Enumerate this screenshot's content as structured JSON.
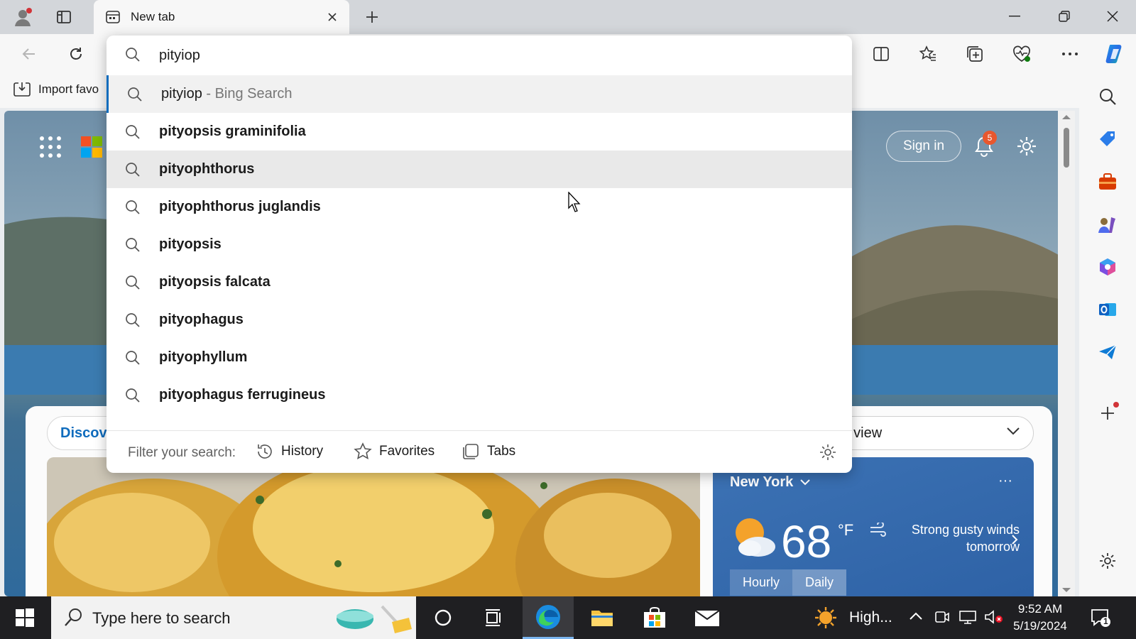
{
  "browser": {
    "tab_title": "New tab",
    "import_favorites_label": "Import favo"
  },
  "omnibox": {
    "value": "pityiop",
    "suggestions": [
      {
        "text": "pityiop",
        "suffix": " - Bing Search"
      },
      {
        "text": "pityopsis graminifolia"
      },
      {
        "text": "pityophthorus"
      },
      {
        "text": "pityophthorus juglandis"
      },
      {
        "text": "pityopsis"
      },
      {
        "text": "pityopsis falcata"
      },
      {
        "text": "pityophagus"
      },
      {
        "text": "pityophyllum"
      },
      {
        "text": "pityophagus ferrugineus"
      }
    ],
    "filter_label": "Filter your search:",
    "filters": [
      "History",
      "Favorites",
      "Tabs"
    ]
  },
  "page": {
    "sign_in": "Sign in",
    "notifications_count": "5",
    "discover_label": "Discove",
    "view_select": "tial view"
  },
  "weather": {
    "city": "New York",
    "temp": "68",
    "unit": "°F",
    "desc": "Strong gusty winds tomorrow",
    "tabs": [
      "Hourly",
      "Daily"
    ],
    "more": "···"
  },
  "taskbar": {
    "search_placeholder": "Type here to search",
    "tray_text": "High...",
    "time": "9:52 AM",
    "date": "5/19/2024",
    "notif_count": "1"
  },
  "colors": {
    "accent": "#0f6cbd",
    "badge": "#e8572e",
    "taskbar": "#1f1f22"
  }
}
